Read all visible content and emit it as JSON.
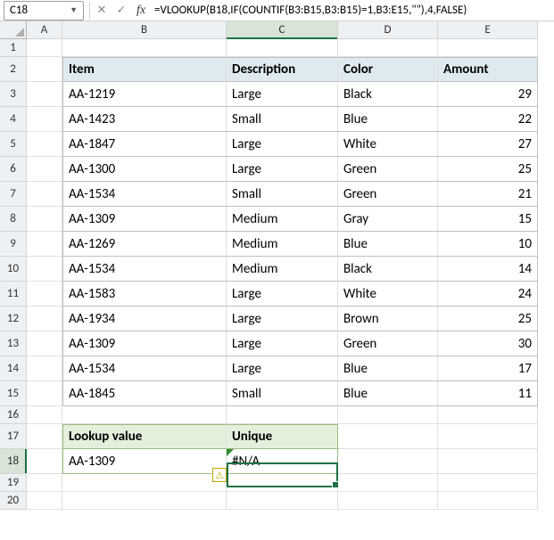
{
  "nameBox": "C18",
  "formula": "=VLOOKUP(B18,IF(COUNTIF(B3:B15,B3:B15)=1,B3:E15,\"\"),4,FALSE)",
  "columns": [
    "A",
    "B",
    "C",
    "D",
    "E"
  ],
  "rowCount": 20,
  "selectedCell": {
    "col": "C",
    "row": 18
  },
  "table": {
    "headers": [
      "Item",
      "Description",
      "Color",
      "Amount"
    ],
    "rows": [
      [
        "AA-1219",
        "Large",
        "Black",
        "29"
      ],
      [
        "AA-1423",
        "Small",
        "Blue",
        "22"
      ],
      [
        "AA-1847",
        "Large",
        "White",
        "27"
      ],
      [
        "AA-1300",
        "Large",
        "Green",
        "25"
      ],
      [
        "AA-1534",
        "Small",
        "Green",
        "21"
      ],
      [
        "AA-1309",
        "Medium",
        "Gray",
        "15"
      ],
      [
        "AA-1269",
        "Medium",
        "Blue",
        "10"
      ],
      [
        "AA-1534",
        "Medium",
        "Black",
        "14"
      ],
      [
        "AA-1583",
        "Large",
        "White",
        "24"
      ],
      [
        "AA-1934",
        "Large",
        "Brown",
        "25"
      ],
      [
        "AA-1309",
        "Large",
        "Green",
        "30"
      ],
      [
        "AA-1534",
        "Large",
        "Blue",
        "17"
      ],
      [
        "AA-1845",
        "Small",
        "Blue",
        "11"
      ]
    ]
  },
  "lookup": {
    "headers": [
      "Lookup value",
      "Unique"
    ],
    "value": "AA-1309",
    "result": "#N/A"
  }
}
